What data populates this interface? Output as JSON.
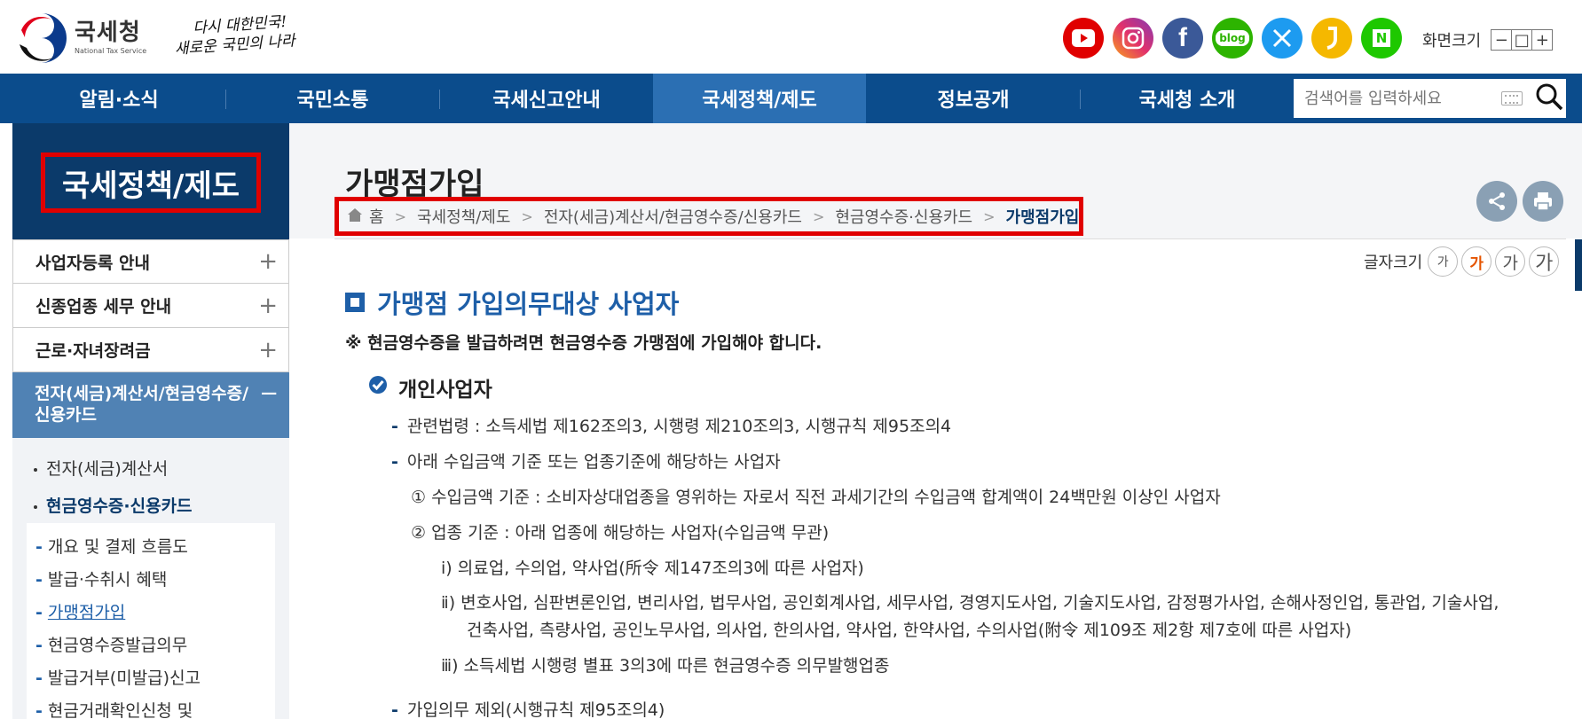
{
  "header": {
    "logo_name": "국세청",
    "logo_eng": "National Tax Service",
    "slogan_line1": "다시 대한민국!",
    "slogan_line2": "새로운 국민의 나라",
    "sns": [
      {
        "name": "youtube-icon",
        "color": "#e00000",
        "glyph": "▶"
      },
      {
        "name": "instagram-icon",
        "color": "#d6249f",
        "glyph": "◎"
      },
      {
        "name": "facebook-icon",
        "color": "#3b5998",
        "glyph": "f"
      },
      {
        "name": "blog-icon",
        "color": "#2db400",
        "glyph": "blog"
      },
      {
        "name": "x-icon",
        "color": "#1d9bf0",
        "glyph": "X"
      },
      {
        "name": "kakao-story-icon",
        "color": "#f5b800",
        "glyph": "❙"
      },
      {
        "name": "naver-post-icon",
        "color": "#1ec800",
        "glyph": "N"
      }
    ],
    "screen_size_label": "화면크기",
    "screen_size_minus": "−",
    "screen_size_reset": "□",
    "screen_size_plus": "+"
  },
  "gnb": {
    "items": [
      "알림·소식",
      "국민소통",
      "국세신고안내",
      "국세정책/제도",
      "정보공개",
      "국세청 소개"
    ],
    "active_index": 3,
    "search_placeholder": "검색어를 입력하세요"
  },
  "sidebar": {
    "title": "국세정책/제도",
    "menu": [
      {
        "label": "사업자등록 안내",
        "toggle": "+"
      },
      {
        "label": "신종업종 세무 안내",
        "toggle": "+"
      },
      {
        "label": "근로·자녀장려금",
        "toggle": "+"
      },
      {
        "label": "전자(세금)계산서/현금영수증/신용카드",
        "label_line1": "전자(세금)계산서/현금영수증/",
        "label_line2": "신용카드",
        "toggle": "−"
      }
    ],
    "sub": [
      "전자(세금)계산서",
      "현금영수증·신용카드"
    ],
    "sub_list": [
      "개요 및 결제 흐름도",
      "발급·수취시 혜택",
      "가맹점가입",
      "현금영수증발급의무",
      "발급거부(미발급)신고",
      "현금거래확인신청 및"
    ]
  },
  "content": {
    "page_title": "가맹점가입",
    "breadcrumb": [
      "홈",
      "국세정책/제도",
      "전자(세금)계산서/현금영수증/신용카드",
      "현금영수증·신용카드",
      "가맹점가입"
    ],
    "font_size_label": "글자크기",
    "font_size_buttons": [
      "가",
      "가",
      "가",
      "가"
    ],
    "section_title": "가맹점 가입의무대상 사업자",
    "notice": "※ 현금영수증을 발급하려면 현금영수증 가맹점에 가입해야 합니다.",
    "sub_title": "개인사업자",
    "line1": "관련법령 : 소득세법 제162조의3, 시행령 제210조의3, 시행규칙 제95조의4",
    "line2": "아래 수입금액 기준 또는 업종기준에 해당하는 사업자",
    "line3": "① 수입금액 기준 : 소비자상대업종을 영위하는 자로서 직전 과세기간의 수입금액 합계액이 24백만원 이상인 사업자",
    "line4": "② 업종 기준 : 아래 업종에 해당하는 사업자(수입금액 무관)",
    "line5": "ⅰ) 의료업, 수의업, 약사업(所令 제147조의3에 따른 사업자)",
    "line6a": "ⅱ) 변호사업, 심판변론인업, 변리사업, 법무사업, 공인회계사업, 세무사업, 경영지도사업, 기술지도사업, 감정평가사업, 손해사정인업, 통관업, 기술사업,",
    "line6b": "건축사업, 측량사업, 공인노무사업, 의사업, 한의사업, 약사업, 한약사업, 수의사업(附令 제109조 제2항 제7호에 따른 사업자)",
    "line7": "ⅲ) 소득세법 시행령 별표 3의3에 따른 현금영수증 의무발행업종",
    "line8": "가입의무 제외(시행규칙 제95조의4)"
  }
}
